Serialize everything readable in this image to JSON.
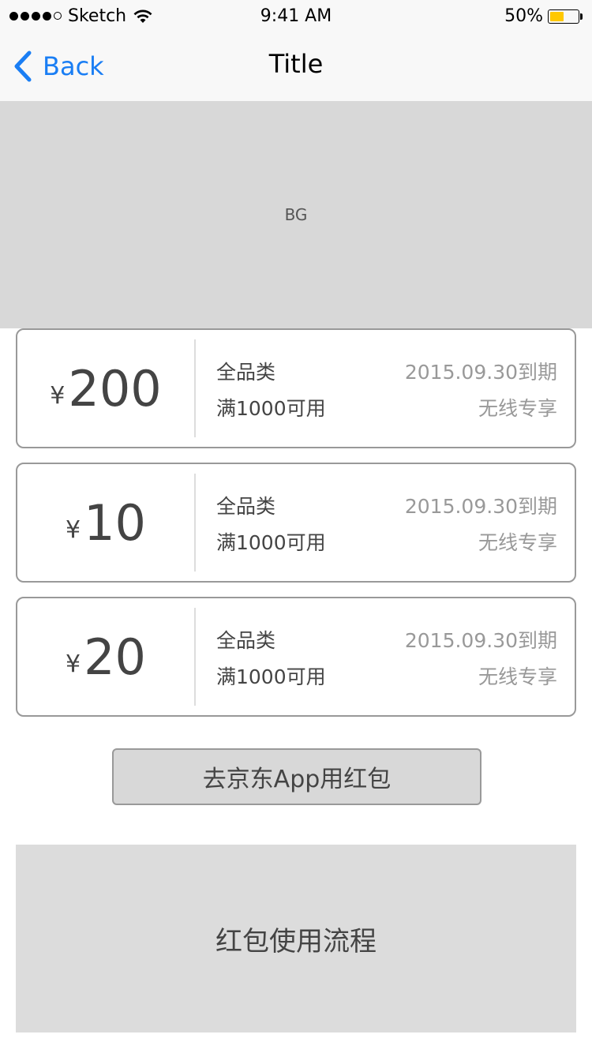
{
  "status_bar": {
    "carrier": "Sketch",
    "time": "9:41 AM",
    "battery_percent": "50%",
    "battery_level": 0.5,
    "battery_color": "#ffc800"
  },
  "nav": {
    "back_label": "Back",
    "title": "Title",
    "back_icon": "chevron-left-icon",
    "accent_color": "#1a7ef4"
  },
  "banner": {
    "label": "BG"
  },
  "coupons": [
    {
      "currency": "¥",
      "amount": "200",
      "category": "全品类",
      "condition": "满1000可用",
      "expiry": "2015.09.30到期",
      "channel": "无线专享"
    },
    {
      "currency": "¥",
      "amount": "10",
      "category": "全品类",
      "condition": "满1000可用",
      "expiry": "2015.09.30到期",
      "channel": "无线专享"
    },
    {
      "currency": "¥",
      "amount": "20",
      "category": "全品类",
      "condition": "满1000可用",
      "expiry": "2015.09.30到期",
      "channel": "无线专享"
    }
  ],
  "actions": {
    "use_label": "去京东App用红包"
  },
  "process": {
    "label": "红包使用流程"
  }
}
